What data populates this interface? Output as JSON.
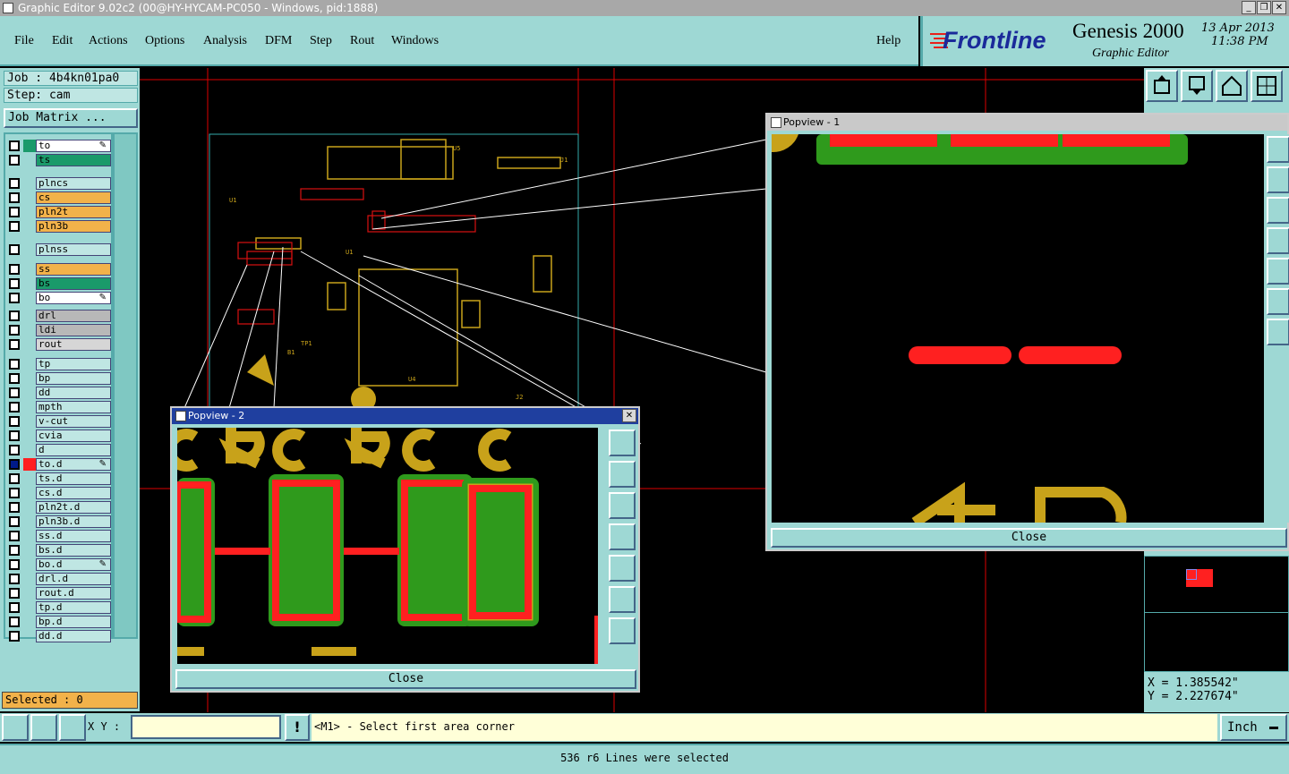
{
  "window": {
    "title": "Graphic Editor 9.02c2 (00@HY-HYCAM-PC050 - Windows, pid:1888)"
  },
  "menu": {
    "items": [
      "File",
      "Edit",
      "Actions",
      "Options",
      "Analysis",
      "DFM",
      "Step",
      "Rout",
      "Windows"
    ],
    "help": "Help"
  },
  "brand": {
    "logo": "Frontline",
    "product": "Genesis 2000",
    "subtitle": "Graphic Editor",
    "date": "13 Apr 2013",
    "time": "11:38 PM"
  },
  "job": {
    "job_label": "Job : 4b4kn01pa0",
    "step_label": "Step: cam",
    "matrix_button": "Job Matrix ..."
  },
  "layers": [
    {
      "name": "to",
      "color": "#ffffff",
      "sw": "#1a9a6a",
      "check": "#fff",
      "flag": "pen"
    },
    {
      "name": "ts",
      "color": "#1a9a6a",
      "sw": "",
      "check": "#fff",
      "flag": ""
    },
    {
      "name": "plncs",
      "color": "#bfe6e3",
      "sw": "",
      "check": "#fff",
      "flag": ""
    },
    {
      "name": "cs",
      "color": "#f2b24a",
      "sw": "",
      "check": "#fff",
      "flag": ""
    },
    {
      "name": "pln2t",
      "color": "#f2b24a",
      "sw": "",
      "check": "#fff",
      "flag": ""
    },
    {
      "name": "pln3b",
      "color": "#f2b24a",
      "sw": "",
      "check": "#fff",
      "flag": ""
    },
    {
      "name": "plnss",
      "color": "#bfe6e3",
      "sw": "",
      "check": "#fff",
      "flag": ""
    },
    {
      "name": "ss",
      "color": "#f2b24a",
      "sw": "",
      "check": "#fff",
      "flag": ""
    },
    {
      "name": "bs",
      "color": "#1a9a6a",
      "sw": "",
      "check": "#fff",
      "flag": ""
    },
    {
      "name": "bo",
      "color": "#ffffff",
      "sw": "",
      "check": "#fff",
      "flag": "pen"
    },
    {
      "name": "drl",
      "color": "#b8b8b8",
      "sw": "",
      "check": "#fff",
      "flag": ""
    },
    {
      "name": "ldi",
      "color": "#b8b8b8",
      "sw": "",
      "check": "#fff",
      "flag": ""
    },
    {
      "name": "rout",
      "color": "#d6d6d6",
      "sw": "",
      "check": "#fff",
      "flag": ""
    },
    {
      "name": "tp",
      "color": "#bfe6e3",
      "sw": "",
      "check": "#fff",
      "flag": ""
    },
    {
      "name": "bp",
      "color": "#bfe6e3",
      "sw": "",
      "check": "#fff",
      "flag": ""
    },
    {
      "name": "dd",
      "color": "#bfe6e3",
      "sw": "",
      "check": "#fff",
      "flag": ""
    },
    {
      "name": "mpth",
      "color": "#bfe6e3",
      "sw": "",
      "check": "#fff",
      "flag": ""
    },
    {
      "name": "v-cut",
      "color": "#bfe6e3",
      "sw": "",
      "check": "#fff",
      "flag": ""
    },
    {
      "name": "cvia",
      "color": "#bfe6e3",
      "sw": "",
      "check": "#fff",
      "flag": ""
    },
    {
      "name": "d",
      "color": "#bfe6e3",
      "sw": "",
      "check": "#fff",
      "flag": ""
    },
    {
      "name": "to.d",
      "color": "#bfe6e3",
      "sw": "#ff2020",
      "check": "#001a8a",
      "flag": "pen"
    },
    {
      "name": "ts.d",
      "color": "#bfe6e3",
      "sw": "",
      "check": "#fff",
      "flag": ""
    },
    {
      "name": "cs.d",
      "color": "#bfe6e3",
      "sw": "",
      "check": "#fff",
      "flag": ""
    },
    {
      "name": "pln2t.d",
      "color": "#bfe6e3",
      "sw": "",
      "check": "#fff",
      "flag": ""
    },
    {
      "name": "pln3b.d",
      "color": "#bfe6e3",
      "sw": "",
      "check": "#fff",
      "flag": ""
    },
    {
      "name": "ss.d",
      "color": "#bfe6e3",
      "sw": "",
      "check": "#fff",
      "flag": ""
    },
    {
      "name": "bs.d",
      "color": "#bfe6e3",
      "sw": "",
      "check": "#fff",
      "flag": ""
    },
    {
      "name": "bo.d",
      "color": "#bfe6e3",
      "sw": "",
      "check": "#fff",
      "flag": "pen"
    },
    {
      "name": "drl.d",
      "color": "#bfe6e3",
      "sw": "",
      "check": "#fff",
      "flag": ""
    },
    {
      "name": "rout.d",
      "color": "#bfe6e3",
      "sw": "",
      "check": "#fff",
      "flag": ""
    },
    {
      "name": "tp.d",
      "color": "#bfe6e3",
      "sw": "",
      "check": "#fff",
      "flag": ""
    },
    {
      "name": "bp.d",
      "color": "#bfe6e3",
      "sw": "",
      "check": "#fff",
      "flag": ""
    },
    {
      "name": "dd.d",
      "color": "#bfe6e3",
      "sw": "",
      "check": "#fff",
      "flag": ""
    }
  ],
  "selected": {
    "label": "Selected : 0"
  },
  "popview1": {
    "title": "Popview - 1",
    "close": "Close"
  },
  "popview2": {
    "title": "Popview - 2",
    "close": "Close"
  },
  "coords": {
    "x": "X = 1.385542\"",
    "y": "Y = 2.227674\""
  },
  "status": {
    "xy_label": "X Y :",
    "xy_value": "",
    "prompt": "<M1> - Select first area corner",
    "units": "Inch"
  },
  "message": "536 r6 Lines were selected",
  "colors": {
    "panel": "#9ed8d4",
    "copper": "#ff2020",
    "mask": "#2f9a1c",
    "silk": "#c8a21a"
  }
}
